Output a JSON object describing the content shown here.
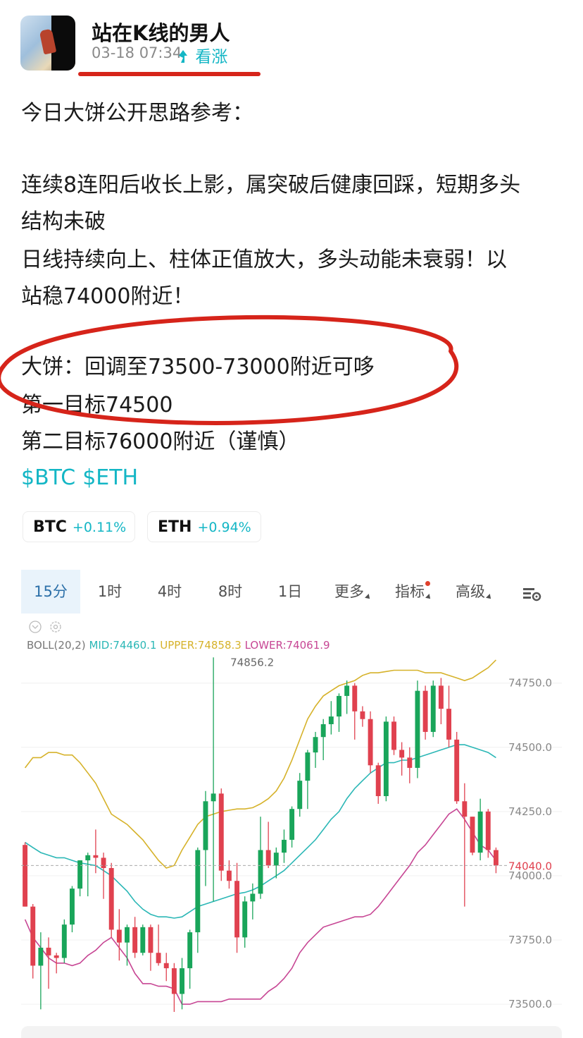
{
  "author": {
    "name": "站在K线的男人",
    "time": "03-18 07:34",
    "sentiment": "看涨"
  },
  "post": {
    "lines": [
      "今日大饼公开思路参考：",
      "连续8连阳后收长上影，属突破后健康回踩，短期多头",
      "结构未破",
      "日线持续向上、柱体正值放大，多头动能未衰弱！以",
      "站稳74000附近！",
      "大饼：回调至73500-73000附近可哆",
      "第一目标74500",
      "第二目标76000附近（谨慎）"
    ],
    "tags": [
      "$BTC",
      "$ETH"
    ]
  },
  "tickers": [
    {
      "symbol": "BTC",
      "change": "+0.11%"
    },
    {
      "symbol": "ETH",
      "change": "+0.94%"
    }
  ],
  "chart": {
    "tabs": [
      "15分",
      "1时",
      "4时",
      "8时",
      "1日",
      "更多",
      "指标",
      "高级"
    ],
    "active_tab": "15分",
    "indicator": {
      "label": "BOLL(20,2)",
      "mid": "MID:74460.1",
      "upper": "UPPER:74858.3",
      "lower": "LOWER:74061.9"
    },
    "high_marker": "74856.2",
    "current_price": "74040.0",
    "colors": {
      "up": "#19a55a",
      "down": "#e0414f",
      "mid": "#2bb7b6",
      "upper": "#d6b22a",
      "lower": "#c74694",
      "accent": "#13b6c5",
      "annotation": "#d6241a"
    }
  },
  "chart_data": {
    "type": "candlestick",
    "y_ticks": [
      "74750.0",
      "74500.0",
      "74250.0",
      "74000.0",
      "73750.0",
      "73500.0"
    ],
    "ylim": [
      73470,
      74870
    ],
    "candles": [
      [
        74120,
        74130,
        73880,
        73880
      ],
      [
        73880,
        73890,
        73600,
        73650
      ],
      [
        73650,
        73780,
        73480,
        73720
      ],
      [
        73720,
        73760,
        73560,
        73690
      ],
      [
        73690,
        73700,
        73620,
        73680
      ],
      [
        73680,
        73830,
        73660,
        73810
      ],
      [
        73810,
        73960,
        73780,
        73950
      ],
      [
        73950,
        74060,
        73920,
        74060
      ],
      [
        74060,
        74090,
        73920,
        74080
      ],
      [
        74080,
        74180,
        74010,
        74070
      ],
      [
        74070,
        74090,
        73910,
        74030
      ],
      [
        74030,
        74050,
        73760,
        73790
      ],
      [
        73790,
        73870,
        73670,
        73740
      ],
      [
        73740,
        73810,
        73650,
        73800
      ],
      [
        73800,
        73840,
        73680,
        73700
      ],
      [
        73700,
        73810,
        73690,
        73800
      ],
      [
        73800,
        73810,
        73630,
        73700
      ],
      [
        73700,
        73810,
        73650,
        73660
      ],
      [
        73660,
        73700,
        73590,
        73640
      ],
      [
        73640,
        73660,
        73470,
        73540
      ],
      [
        73540,
        73680,
        73480,
        73640
      ],
      [
        73640,
        73790,
        73560,
        73780
      ],
      [
        73780,
        74110,
        73700,
        74100
      ],
      [
        74100,
        74330,
        73960,
        74290
      ],
      [
        74290,
        74850,
        73900,
        74320
      ],
      [
        74320,
        74340,
        73980,
        74020
      ],
      [
        74020,
        74060,
        73950,
        73980
      ],
      [
        73980,
        74050,
        73700,
        73760
      ],
      [
        73760,
        73920,
        73720,
        73900
      ],
      [
        73900,
        73970,
        73830,
        73930
      ],
      [
        73930,
        74230,
        73910,
        74100
      ],
      [
        74100,
        74210,
        74030,
        74040
      ],
      [
        74040,
        74110,
        73990,
        74090
      ],
      [
        74090,
        74180,
        74050,
        74140
      ],
      [
        74140,
        74270,
        74110,
        74260
      ],
      [
        74260,
        74400,
        74230,
        74370
      ],
      [
        74370,
        74490,
        74260,
        74480
      ],
      [
        74480,
        74560,
        74420,
        74540
      ],
      [
        74540,
        74610,
        74450,
        74590
      ],
      [
        74590,
        74680,
        74550,
        74620
      ],
      [
        74620,
        74710,
        74560,
        74700
      ],
      [
        74700,
        74760,
        74630,
        74740
      ],
      [
        74740,
        74750,
        74530,
        74640
      ],
      [
        74640,
        74660,
        74580,
        74610
      ],
      [
        74610,
        74640,
        74400,
        74430
      ],
      [
        74430,
        74440,
        74280,
        74310
      ],
      [
        74310,
        74620,
        74290,
        74600
      ],
      [
        74600,
        74620,
        74470,
        74490
      ],
      [
        74490,
        74520,
        74390,
        74460
      ],
      [
        74460,
        74500,
        74360,
        74420
      ],
      [
        74420,
        74760,
        74380,
        74720
      ],
      [
        74720,
        74740,
        74530,
        74560
      ],
      [
        74560,
        74760,
        74540,
        74740
      ],
      [
        74740,
        74770,
        74590,
        74650
      ],
      [
        74650,
        74740,
        74500,
        74530
      ],
      [
        74530,
        74560,
        74280,
        74290
      ],
      [
        74290,
        74360,
        73880,
        74230
      ],
      [
        74230,
        74230,
        74080,
        74090
      ],
      [
        74090,
        74300,
        74060,
        74250
      ],
      [
        74250,
        74260,
        74070,
        74100
      ],
      [
        74100,
        74110,
        74010,
        74040
      ]
    ],
    "series": [
      {
        "name": "MID",
        "values": [
          74130,
          74110,
          74090,
          74080,
          74070,
          74070,
          74060,
          74050,
          74045,
          74040,
          74020,
          74000,
          73970,
          73940,
          73900,
          73870,
          73850,
          73840,
          73840,
          73835,
          73840,
          73860,
          73880,
          73890,
          73900,
          73910,
          73920,
          73930,
          73935,
          73945,
          73960,
          73980,
          74000,
          74020,
          74050,
          74080,
          74110,
          74140,
          74180,
          74220,
          74250,
          74300,
          74340,
          74370,
          74400,
          74420,
          74440,
          74440,
          74450,
          74450,
          74460,
          74470,
          74480,
          74490,
          74500,
          74510,
          74510,
          74500,
          74490,
          74480,
          74460
        ]
      },
      {
        "name": "UPPER",
        "values": [
          74420,
          74460,
          74460,
          74480,
          74480,
          74470,
          74470,
          74440,
          74400,
          74360,
          74300,
          74240,
          74220,
          74200,
          74170,
          74140,
          74100,
          74060,
          74030,
          74040,
          74100,
          74150,
          74200,
          74230,
          74240,
          74250,
          74255,
          74260,
          74260,
          74265,
          74280,
          74300,
          74330,
          74380,
          74450,
          74530,
          74610,
          74660,
          74700,
          74720,
          74740,
          74750,
          74760,
          74780,
          74790,
          74790,
          74795,
          74800,
          74800,
          74800,
          74800,
          74790,
          74790,
          74790,
          74780,
          74770,
          74760,
          74770,
          74790,
          74810,
          74840
        ]
      },
      {
        "name": "LOWER",
        "values": [
          73830,
          73760,
          73720,
          73680,
          73660,
          73660,
          73650,
          73660,
          73690,
          73710,
          73740,
          73760,
          73720,
          73680,
          73620,
          73580,
          73580,
          73570,
          73570,
          73560,
          73500,
          73500,
          73510,
          73510,
          73510,
          73510,
          73520,
          73520,
          73520,
          73520,
          73520,
          73550,
          73570,
          73600,
          73640,
          73700,
          73740,
          73770,
          73800,
          73810,
          73820,
          73830,
          73840,
          73840,
          73850,
          73880,
          73920,
          73960,
          74000,
          74040,
          74090,
          74120,
          74160,
          74200,
          74240,
          74260,
          74220,
          74170,
          74120,
          74100,
          74060
        ]
      }
    ]
  }
}
